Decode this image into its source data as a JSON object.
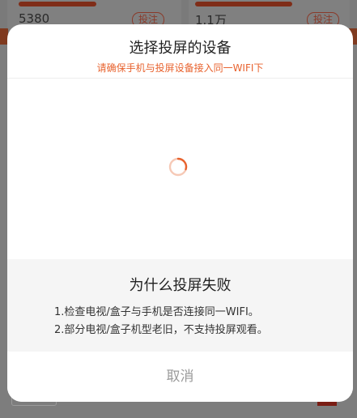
{
  "background": {
    "left_card": {
      "count": "5380",
      "button_label": "投注"
    },
    "right_card": {
      "count": "1.1万",
      "button_label": "投注"
    }
  },
  "dialog": {
    "title": "选择投屏的设备",
    "subtitle": "请确保手机与投屏设备接入同一WIFI下",
    "loading_icon": "spinner-icon",
    "accent_color": "#e8632f",
    "help": {
      "title": "为什么投屏失败",
      "lines": [
        "1.检查电视/盒子与手机是否连接同一WIFI。",
        "2.部分电视/盒子机型老旧，不支持投屏观看。"
      ]
    },
    "cancel_label": "取消"
  }
}
